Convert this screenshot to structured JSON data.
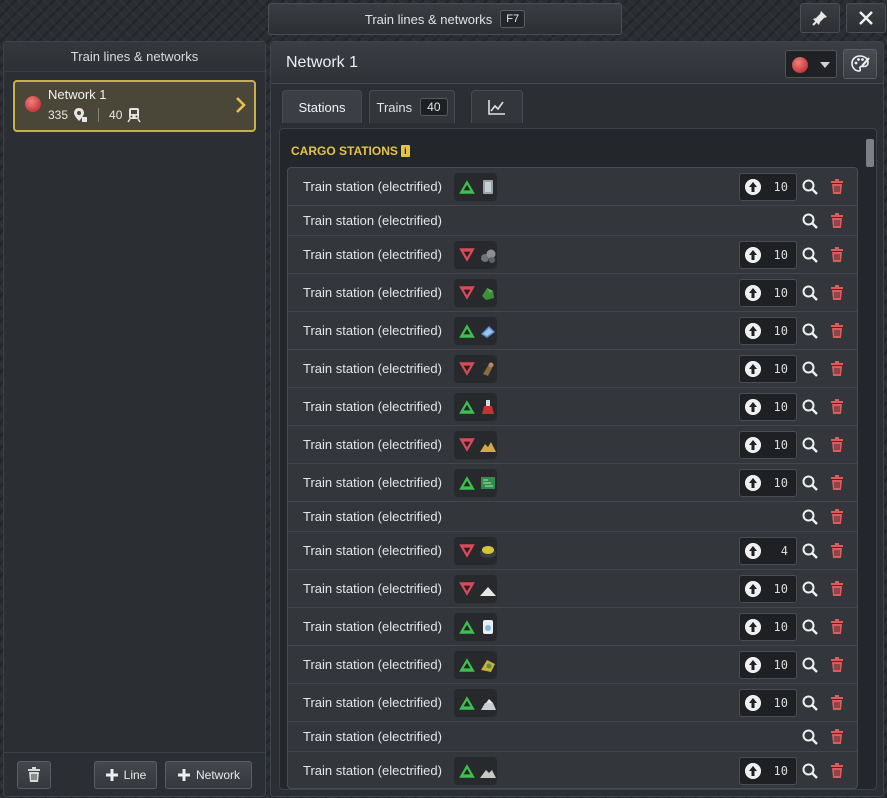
{
  "window": {
    "title": "Train lines & networks",
    "hotkey": "F7"
  },
  "left": {
    "header": "Train lines & networks",
    "network": {
      "name": "Network 1",
      "stations": "335",
      "trains": "40"
    },
    "footer": {
      "line_label": "Line",
      "network_label": "Network"
    }
  },
  "right": {
    "title": "Network 1",
    "line_color": "#d64545",
    "tabs": [
      {
        "label": "Stations"
      },
      {
        "label": "Trains",
        "count": "40"
      }
    ],
    "section_title": "CARGO STATIONS",
    "section_info": "i"
  },
  "stations": [
    {
      "label": "Train station (electrified)",
      "dir": "up",
      "cargo": "iron-plate",
      "prio": "10"
    },
    {
      "label": "Train station (electrified)",
      "dir": null,
      "cargo": null,
      "prio": null
    },
    {
      "label": "Train station (electrified)",
      "dir": "down",
      "cargo": "stone-rocks",
      "prio": "10"
    },
    {
      "label": "Train station (electrified)",
      "dir": "down",
      "cargo": "green-ore",
      "prio": "10"
    },
    {
      "label": "Train station (electrified)",
      "dir": "up",
      "cargo": "blue-panel",
      "prio": "10"
    },
    {
      "label": "Train station (electrified)",
      "dir": "down",
      "cargo": "wood",
      "prio": "10"
    },
    {
      "label": "Train station (electrified)",
      "dir": "up",
      "cargo": "red-flask",
      "prio": "10"
    },
    {
      "label": "Train station (electrified)",
      "dir": "down",
      "cargo": "sand-pile",
      "prio": "10"
    },
    {
      "label": "Train station (electrified)",
      "dir": "up",
      "cargo": "circuit-board",
      "prio": "10"
    },
    {
      "label": "Train station (electrified)",
      "dir": null,
      "cargo": null,
      "prio": null
    },
    {
      "label": "Train station (electrified)",
      "dir": "down",
      "cargo": "yellow-ore",
      "prio": "4"
    },
    {
      "label": "Train station (electrified)",
      "dir": "down",
      "cargo": "white-powder",
      "prio": "10"
    },
    {
      "label": "Train station (electrified)",
      "dir": "up",
      "cargo": "glass-container",
      "prio": "10"
    },
    {
      "label": "Train station (electrified)",
      "dir": "up",
      "cargo": "yellow-machine",
      "prio": "10"
    },
    {
      "label": "Train station (electrified)",
      "dir": "up",
      "cargo": "silver-ingot",
      "prio": "10"
    },
    {
      "label": "Train station (electrified)",
      "dir": null,
      "cargo": null,
      "prio": null
    },
    {
      "label": "Train station (electrified)",
      "dir": "up",
      "cargo": "gray-pile",
      "prio": "10"
    }
  ]
}
